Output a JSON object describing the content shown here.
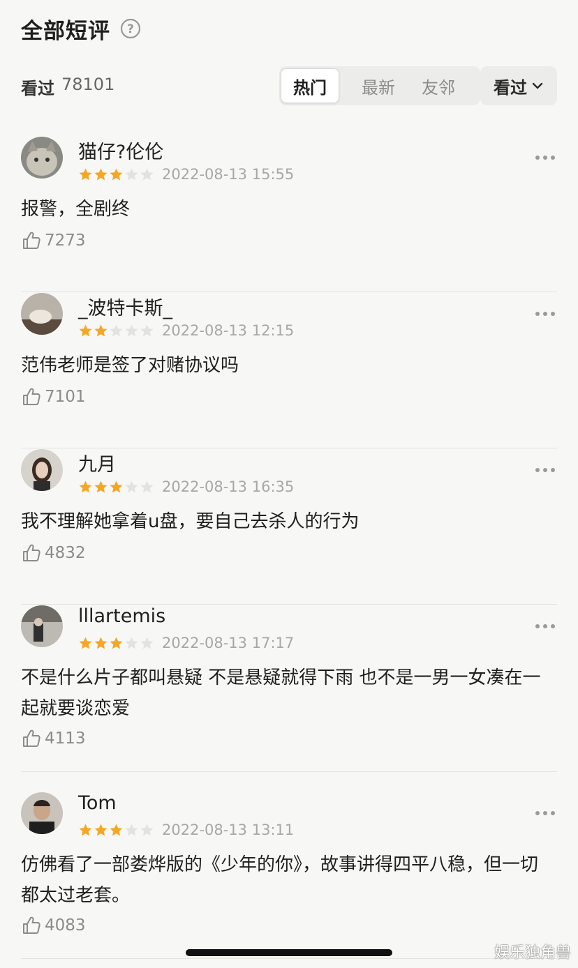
{
  "header": {
    "title": "全部短评",
    "help_icon": "question-circle-icon"
  },
  "filter": {
    "seen_label": "看过",
    "seen_count": "78101",
    "tabs": [
      {
        "label": "热门",
        "active": true
      },
      {
        "label": "最新",
        "active": false
      },
      {
        "label": "友邻",
        "active": false
      }
    ],
    "dropdown_label": "看过",
    "dropdown_icon": "chevron-down-icon"
  },
  "comments": [
    {
      "user": "猫仔?伦伦",
      "rating": 3,
      "date": "2022-08-13 15:55",
      "text": "报警，全剧终",
      "likes": "7273"
    },
    {
      "user": "_波特卡斯_",
      "rating": 2,
      "date": "2022-08-13 12:15",
      "text": "范伟老师是签了对赌协议吗",
      "likes": "7101"
    },
    {
      "user": "九月",
      "rating": 3,
      "date": "2022-08-13 16:35",
      "text": "我不理解她拿着u盘，要自己去杀人的行为",
      "likes": "4832"
    },
    {
      "user": "lllartemis",
      "rating": 3,
      "date": "2022-08-13 17:17",
      "text": "不是什么片子都叫悬疑 不是悬疑就得下雨 也不是一男一女凑在一起就要谈恋爱",
      "likes": "4113"
    },
    {
      "user": "Tom",
      "rating": 3,
      "date": "2022-08-13 13:11",
      "text": "仿佛看了一部娄烨版的《少年的你》，故事讲得四平八稳，但一切都太过老套。",
      "likes": "4083"
    }
  ],
  "watermark": "娱乐独角兽",
  "colors": {
    "star_filled": "#f5a623",
    "star_empty": "#e2e2e2",
    "background": "#f7f7f5"
  }
}
